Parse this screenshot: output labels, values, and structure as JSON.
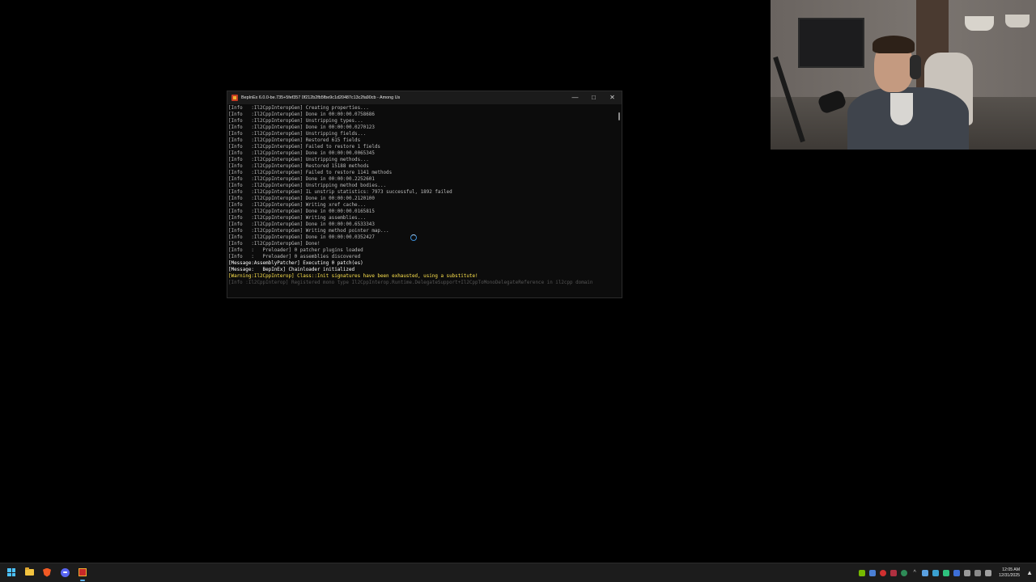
{
  "window": {
    "title": "BepInEx 6.0.0-be.735+5fef357 0f212b2fb5fbe9c1d20487c13c2fa90cb - Among Us",
    "controls": {
      "minimize": "—",
      "maximize": "□",
      "close": "✕"
    }
  },
  "console": {
    "lines": [
      "[Info   :Il2CppInteropGen] Creating properties...",
      "[Info   :Il2CppInteropGen] Done in 00:00:00.0758686",
      "[Info   :Il2CppInteropGen] Unstripping types...",
      "[Info   :Il2CppInteropGen] Done in 00:00:00.0270123",
      "[Info   :Il2CppInteropGen] Unstripping fields...",
      "[Info   :Il2CppInteropGen] Restored 615 fields",
      "[Info   :Il2CppInteropGen] Failed to restore 1 fields",
      "[Info   :Il2CppInteropGen] Done in 00:00:00.0065345",
      "[Info   :Il2CppInteropGen] Unstripping methods...",
      "[Info   :Il2CppInteropGen] Restored 15188 methods",
      "[Info   :Il2CppInteropGen] Failed to restore 1141 methods",
      "[Info   :Il2CppInteropGen] Done in 00:00:00.2252601",
      "[Info   :Il2CppInteropGen] Unstripping method bodies...",
      "[Info   :Il2CppInteropGen] IL unstrip statistics: 7973 successful, 1892 failed",
      "[Info   :Il2CppInteropGen] Done in 00:00:00.2120100",
      "[Info   :Il2CppInteropGen] Writing xref cache...",
      "[Info   :Il2CppInteropGen] Done in 00:00:00.0165815",
      "[Info   :Il2CppInteropGen] Writing assemblies...",
      "[Info   :Il2CppInteropGen] Done in 00:00:00.6533343",
      "[Info   :Il2CppInteropGen] Writing method pointer map...",
      "[Info   :Il2CppInteropGen] Done in 00:00:00.0352427",
      "[Info   :Il2CppInteropGen] Done!",
      "[Info   :   Preloader] 0 patcher plugins loaded",
      "[Info   :   Preloader] 0 assemblies discovered"
    ],
    "message_lines": [
      "[Message:AssemblyPatcher] Executing 0 patch(es)",
      "[Message:   BepInEx] Chainloader initialized"
    ],
    "warning_line": "[Warning:Il2CppInterop] Class::Init signatures have been exhausted, using a substitute!",
    "dim_line": "[Info   :Il2CppInterop] Registered mono type Il2CppInterop.Runtime.DelegateSupport+Il2CppToMonoDelegateReference in il2cpp domain"
  },
  "taskbar": {
    "apps": [
      "start-icon",
      "file-explorer-icon",
      "brave-browser-icon",
      "discord-icon",
      "bepinex-console-icon"
    ],
    "tray_icons": [
      "nvidia-icon",
      "app-tray-icon",
      "record-icon",
      "microphone-icon",
      "chevron-up-icon",
      "wifi-icon",
      "bluetooth-icon",
      "battery-icon",
      "display-icon",
      "volume-icon"
    ],
    "clock_time": "12:05 AM",
    "clock_date": "12/31/2025"
  },
  "colors": {
    "console_bg": "#0c0c0c",
    "warning": "#ffe44d",
    "taskbar_bg": "#1c1c1c",
    "accent": "#5fb2f2"
  }
}
